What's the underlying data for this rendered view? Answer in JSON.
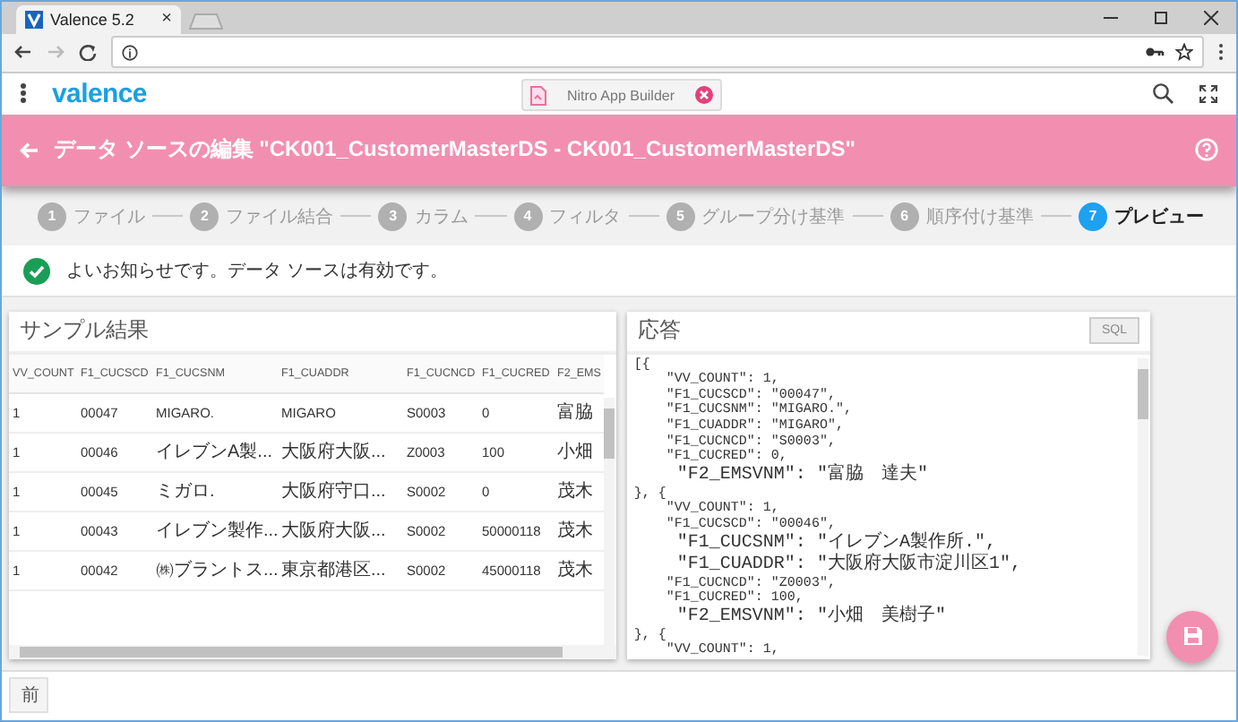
{
  "browser": {
    "tab_title": "Valence 5.2",
    "tab_close": "×"
  },
  "app_header": {
    "logo": "valence",
    "open_app": {
      "label": "Nitro App Builder"
    }
  },
  "title_bar": {
    "title": "データ ソースの編集 \"CK001_CustomerMasterDS - CK001_CustomerMasterDS\""
  },
  "steps": [
    {
      "number": "1",
      "label": "ファイル",
      "selected": false
    },
    {
      "number": "2",
      "label": "ファイル結合",
      "selected": false
    },
    {
      "number": "3",
      "label": "カラム",
      "selected": false
    },
    {
      "number": "4",
      "label": "フィルタ",
      "selected": false
    },
    {
      "number": "5",
      "label": "グループ分け基準",
      "selected": false
    },
    {
      "number": "6",
      "label": "順序付け基準",
      "selected": false
    },
    {
      "number": "7",
      "label": "プレビュー",
      "selected": true
    }
  ],
  "notice": {
    "text": "よいお知らせです。データ ソースは有効です。"
  },
  "sample_results": {
    "title": "サンプル結果",
    "columns": [
      "VV_COUNT",
      "F1_CUCSCD",
      "F1_CUCSNM",
      "F1_CUADDR",
      "F1_CUCNCD",
      "F1_CUCRED",
      "F2_EMS"
    ],
    "rows": [
      [
        "1",
        "00047",
        "MIGARO.",
        "MIGARO",
        "S0003",
        "0",
        "富脇"
      ],
      [
        "1",
        "00046",
        "イレブンA製...",
        "大阪府大阪...",
        "Z0003",
        "100",
        "小畑"
      ],
      [
        "1",
        "00045",
        "ミガロ.",
        "大阪府守口...",
        "S0002",
        "0",
        "茂木"
      ],
      [
        "1",
        "00043",
        "イレブン製作...",
        "大阪府大阪...",
        "S0002",
        "50000118",
        "茂木"
      ],
      [
        "1",
        "00042",
        "㈱ブラントス...",
        "東京都港区...",
        "S0002",
        "45000118",
        "茂木"
      ]
    ]
  },
  "response": {
    "title": "応答",
    "sql_button": "SQL",
    "lines": [
      "[{",
      "    \"VV_COUNT\": 1,",
      "    \"F1_CUCSCD\": \"00047\",",
      "    \"F1_CUCSNM\": \"MIGARO.\",",
      "    \"F1_CUADDR\": \"MIGARO\",",
      "    \"F1_CUCNCD\": \"S0003\",",
      "    \"F1_CUCRED\": 0,",
      "    \"F2_EMSVNM\": \"富脇　達夫\"",
      "}, {",
      "    \"VV_COUNT\": 1,",
      "    \"F1_CUCSCD\": \"00046\",",
      "    \"F1_CUCSNM\": \"イレブンA製作所.\",",
      "    \"F1_CUADDR\": \"大阪府大阪市淀川区1\",",
      "    \"F1_CUCNCD\": \"Z0003\",",
      "    \"F1_CUCRED\": 100,",
      "    \"F2_EMSVNM\": \"小畑　美樹子\"",
      "}, {",
      "    \"VV_COUNT\": 1,"
    ]
  },
  "footer": {
    "back_button": "前"
  }
}
